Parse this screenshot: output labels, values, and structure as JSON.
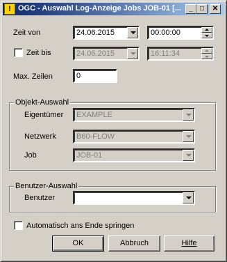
{
  "window": {
    "title": "OGC - Auswahl Log-Anzeige Jobs JOB-01 [...",
    "app_icon_glyph": "!"
  },
  "titlebar_buttons": {
    "minimize": "_",
    "maximize": "□",
    "close": "✕"
  },
  "zeit_von": {
    "label": "Zeit von",
    "date": "24.06.2015",
    "time": "00:00:00"
  },
  "zeit_bis": {
    "label": "Zeit bis",
    "checked": false,
    "date": "24.06.2015",
    "time": "16:11:34"
  },
  "max_zeilen": {
    "label": "Max. Zeilen",
    "value": "0"
  },
  "objekt_auswahl": {
    "group_label": "Objekt-Auswahl",
    "eigentuemer": {
      "label": "Eigentümer",
      "value": "EXAMPLE"
    },
    "netzwerk": {
      "label": "Netzwerk",
      "value": "B60-FLOW"
    },
    "job": {
      "label": "Job",
      "value": "JOB-01"
    }
  },
  "benutzer_auswahl": {
    "group_label": "Benutzer-Auswahl",
    "benutzer": {
      "label": "Benutzer",
      "value": ""
    }
  },
  "auto_end": {
    "label": "Automatisch ans Ende springen",
    "checked": false
  },
  "buttons": {
    "ok": "OK",
    "abbruch": "Abbruch",
    "hilfe": "Hilfe"
  }
}
